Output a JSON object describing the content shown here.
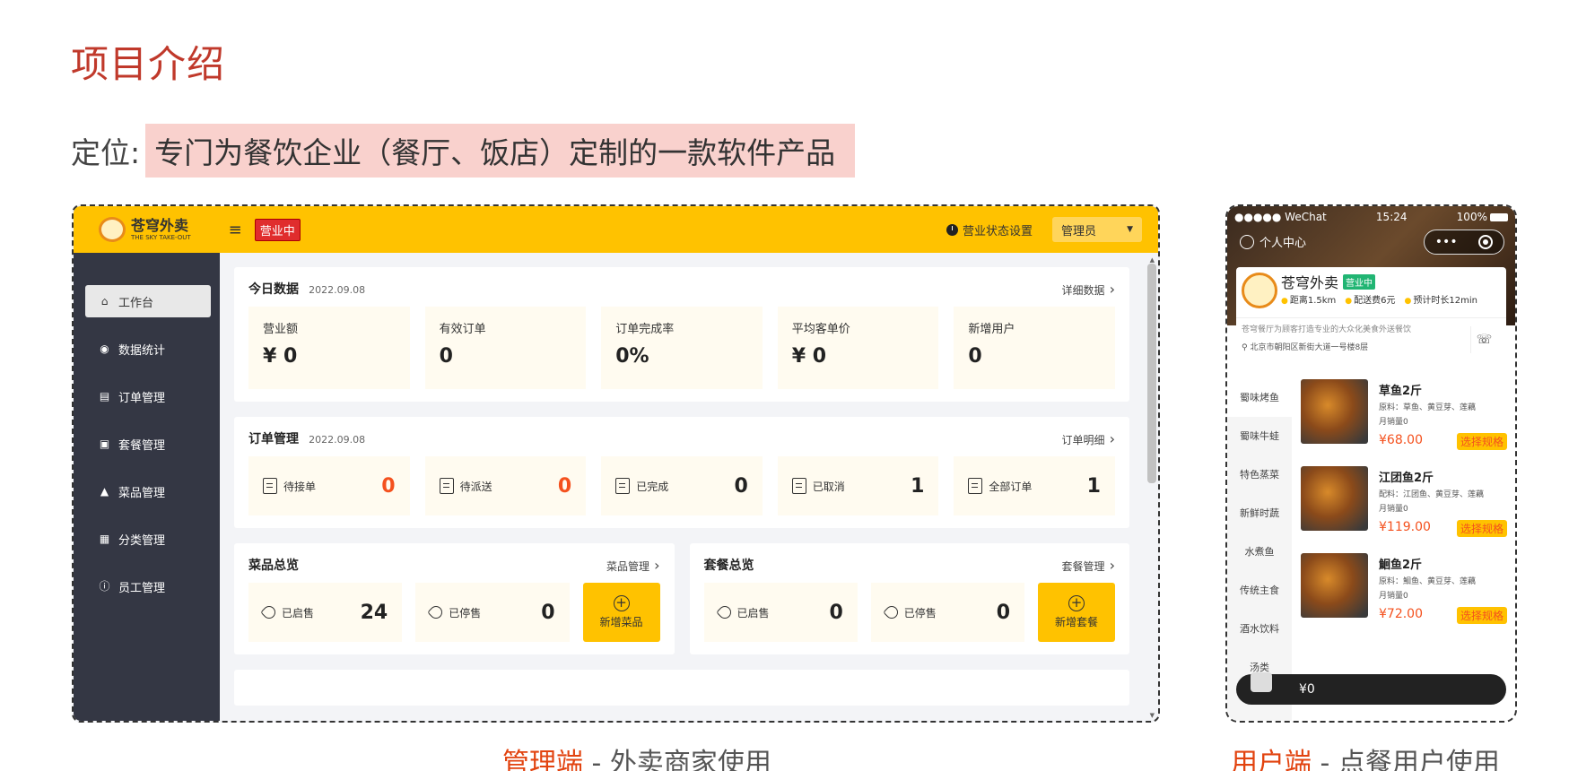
{
  "slide": {
    "title": "项目介绍",
    "position_label": "定位:",
    "position_text": "专门为餐饮企业（餐厅、饭店）定制的一款软件产品"
  },
  "admin": {
    "logo_cn": "苍穹外卖",
    "logo_en": "THE SKY TAKE-OUT",
    "status_tag": "营业中",
    "status_setting": "营业状态设置",
    "user_select": "管理员",
    "sidebar": [
      {
        "label": "工作台",
        "icon": "home-icon"
      },
      {
        "label": "数据统计",
        "icon": "chart-icon"
      },
      {
        "label": "订单管理",
        "icon": "clipboard-icon"
      },
      {
        "label": "套餐管理",
        "icon": "gift-icon"
      },
      {
        "label": "菜品管理",
        "icon": "dish-icon"
      },
      {
        "label": "分类管理",
        "icon": "grid-icon"
      },
      {
        "label": "员工管理",
        "icon": "info-icon"
      }
    ],
    "today": {
      "title": "今日数据",
      "date": "2022.09.08",
      "link": "详细数据",
      "stats": [
        {
          "label": "营业额",
          "value": "¥ 0"
        },
        {
          "label": "有效订单",
          "value": "0"
        },
        {
          "label": "订单完成率",
          "value": "0%"
        },
        {
          "label": "平均客单价",
          "value": "¥ 0"
        },
        {
          "label": "新增用户",
          "value": "0"
        }
      ]
    },
    "orders": {
      "title": "订单管理",
      "date": "2022.09.08",
      "link": "订单明细",
      "items": [
        {
          "label": "待接单",
          "value": "0",
          "highlight": true
        },
        {
          "label": "待派送",
          "value": "0",
          "highlight": true
        },
        {
          "label": "已完成",
          "value": "0",
          "highlight": false
        },
        {
          "label": "已取消",
          "value": "1",
          "highlight": false
        },
        {
          "label": "全部订单",
          "value": "1",
          "highlight": false
        }
      ]
    },
    "dishes": {
      "title": "菜品总览",
      "link": "菜品管理",
      "on_label": "已启售",
      "on_value": "24",
      "off_label": "已停售",
      "off_value": "0",
      "add_label": "新增菜品"
    },
    "setmeals": {
      "title": "套餐总览",
      "link": "套餐管理",
      "on_label": "已启售",
      "on_value": "0",
      "off_label": "已停售",
      "off_value": "0",
      "add_label": "新增套餐"
    }
  },
  "phone": {
    "carrier": "●●●●● WeChat",
    "time": "15:24",
    "battery": "100%",
    "user_center": "个人中心",
    "capsule_dots": "•••",
    "shop_name": "苍穹外卖",
    "open_tag": "营业中",
    "distance": "距离1.5km",
    "delivery_fee": "配送费6元",
    "eta": "预计时长12min",
    "description": "苍穹餐厅为顾客打造专业的大众化美食外送餐饮",
    "address": "北京市朝阳区新街大道一号楼8层",
    "categories": [
      "蜀味烤鱼",
      "蜀味牛蛙",
      "特色蒸菜",
      "新鲜时蔬",
      "水煮鱼",
      "传统主食",
      "酒水饮料",
      "汤类"
    ],
    "dish_list": [
      {
        "name": "草鱼2斤",
        "ingredients": "原料：草鱼、黄豆芽、莲藕",
        "sales": "月销量0",
        "price": "¥68.00",
        "button": "选择规格"
      },
      {
        "name": "江团鱼2斤",
        "ingredients": "配料：江团鱼、黄豆芽、莲藕",
        "sales": "月销量0",
        "price": "¥119.00",
        "button": "选择规格"
      },
      {
        "name": "鮰鱼2斤",
        "ingredients": "原料：鮰鱼、黄豆芽、莲藕",
        "sales": "月销量0",
        "price": "¥72.00",
        "button": "选择规格"
      }
    ],
    "cart_total": "¥0"
  },
  "captions": {
    "admin_em": "管理端",
    "admin_rest": " - 外卖商家使用",
    "user_em": "用户端",
    "user_rest": " - 点餐用户使用"
  },
  "colors": {
    "accent": "#ffc200",
    "title_red": "#c0392b",
    "sidebar": "#343744",
    "price_red": "#f4511e"
  }
}
